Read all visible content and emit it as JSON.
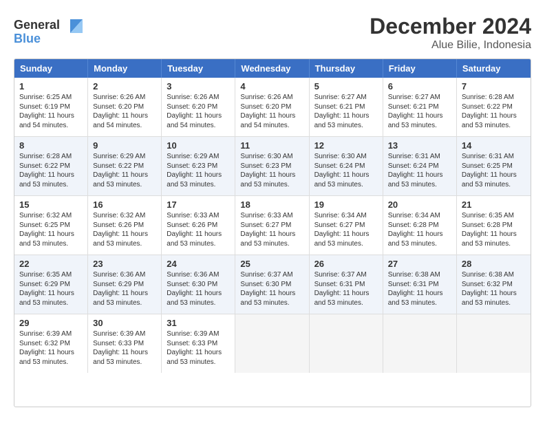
{
  "header": {
    "logo_line1": "General",
    "logo_line2": "Blue",
    "title": "December 2024",
    "subtitle": "Alue Bilie, Indonesia"
  },
  "calendar": {
    "days": [
      "Sunday",
      "Monday",
      "Tuesday",
      "Wednesday",
      "Thursday",
      "Friday",
      "Saturday"
    ],
    "rows": [
      [
        {
          "day": "1",
          "info": "Sunrise: 6:25 AM\nSunset: 6:19 PM\nDaylight: 11 hours\nand 54 minutes."
        },
        {
          "day": "2",
          "info": "Sunrise: 6:26 AM\nSunset: 6:20 PM\nDaylight: 11 hours\nand 54 minutes."
        },
        {
          "day": "3",
          "info": "Sunrise: 6:26 AM\nSunset: 6:20 PM\nDaylight: 11 hours\nand 54 minutes."
        },
        {
          "day": "4",
          "info": "Sunrise: 6:26 AM\nSunset: 6:20 PM\nDaylight: 11 hours\nand 54 minutes."
        },
        {
          "day": "5",
          "info": "Sunrise: 6:27 AM\nSunset: 6:21 PM\nDaylight: 11 hours\nand 53 minutes."
        },
        {
          "day": "6",
          "info": "Sunrise: 6:27 AM\nSunset: 6:21 PM\nDaylight: 11 hours\nand 53 minutes."
        },
        {
          "day": "7",
          "info": "Sunrise: 6:28 AM\nSunset: 6:22 PM\nDaylight: 11 hours\nand 53 minutes."
        }
      ],
      [
        {
          "day": "8",
          "info": "Sunrise: 6:28 AM\nSunset: 6:22 PM\nDaylight: 11 hours\nand 53 minutes."
        },
        {
          "day": "9",
          "info": "Sunrise: 6:29 AM\nSunset: 6:22 PM\nDaylight: 11 hours\nand 53 minutes."
        },
        {
          "day": "10",
          "info": "Sunrise: 6:29 AM\nSunset: 6:23 PM\nDaylight: 11 hours\nand 53 minutes."
        },
        {
          "day": "11",
          "info": "Sunrise: 6:30 AM\nSunset: 6:23 PM\nDaylight: 11 hours\nand 53 minutes."
        },
        {
          "day": "12",
          "info": "Sunrise: 6:30 AM\nSunset: 6:24 PM\nDaylight: 11 hours\nand 53 minutes."
        },
        {
          "day": "13",
          "info": "Sunrise: 6:31 AM\nSunset: 6:24 PM\nDaylight: 11 hours\nand 53 minutes."
        },
        {
          "day": "14",
          "info": "Sunrise: 6:31 AM\nSunset: 6:25 PM\nDaylight: 11 hours\nand 53 minutes."
        }
      ],
      [
        {
          "day": "15",
          "info": "Sunrise: 6:32 AM\nSunset: 6:25 PM\nDaylight: 11 hours\nand 53 minutes."
        },
        {
          "day": "16",
          "info": "Sunrise: 6:32 AM\nSunset: 6:26 PM\nDaylight: 11 hours\nand 53 minutes."
        },
        {
          "day": "17",
          "info": "Sunrise: 6:33 AM\nSunset: 6:26 PM\nDaylight: 11 hours\nand 53 minutes."
        },
        {
          "day": "18",
          "info": "Sunrise: 6:33 AM\nSunset: 6:27 PM\nDaylight: 11 hours\nand 53 minutes."
        },
        {
          "day": "19",
          "info": "Sunrise: 6:34 AM\nSunset: 6:27 PM\nDaylight: 11 hours\nand 53 minutes."
        },
        {
          "day": "20",
          "info": "Sunrise: 6:34 AM\nSunset: 6:28 PM\nDaylight: 11 hours\nand 53 minutes."
        },
        {
          "day": "21",
          "info": "Sunrise: 6:35 AM\nSunset: 6:28 PM\nDaylight: 11 hours\nand 53 minutes."
        }
      ],
      [
        {
          "day": "22",
          "info": "Sunrise: 6:35 AM\nSunset: 6:29 PM\nDaylight: 11 hours\nand 53 minutes."
        },
        {
          "day": "23",
          "info": "Sunrise: 6:36 AM\nSunset: 6:29 PM\nDaylight: 11 hours\nand 53 minutes."
        },
        {
          "day": "24",
          "info": "Sunrise: 6:36 AM\nSunset: 6:30 PM\nDaylight: 11 hours\nand 53 minutes."
        },
        {
          "day": "25",
          "info": "Sunrise: 6:37 AM\nSunset: 6:30 PM\nDaylight: 11 hours\nand 53 minutes."
        },
        {
          "day": "26",
          "info": "Sunrise: 6:37 AM\nSunset: 6:31 PM\nDaylight: 11 hours\nand 53 minutes."
        },
        {
          "day": "27",
          "info": "Sunrise: 6:38 AM\nSunset: 6:31 PM\nDaylight: 11 hours\nand 53 minutes."
        },
        {
          "day": "28",
          "info": "Sunrise: 6:38 AM\nSunset: 6:32 PM\nDaylight: 11 hours\nand 53 minutes."
        }
      ],
      [
        {
          "day": "29",
          "info": "Sunrise: 6:39 AM\nSunset: 6:32 PM\nDaylight: 11 hours\nand 53 minutes."
        },
        {
          "day": "30",
          "info": "Sunrise: 6:39 AM\nSunset: 6:33 PM\nDaylight: 11 hours\nand 53 minutes."
        },
        {
          "day": "31",
          "info": "Sunrise: 6:39 AM\nSunset: 6:33 PM\nDaylight: 11 hours\nand 53 minutes."
        },
        {
          "day": "",
          "info": ""
        },
        {
          "day": "",
          "info": ""
        },
        {
          "day": "",
          "info": ""
        },
        {
          "day": "",
          "info": ""
        }
      ]
    ]
  }
}
